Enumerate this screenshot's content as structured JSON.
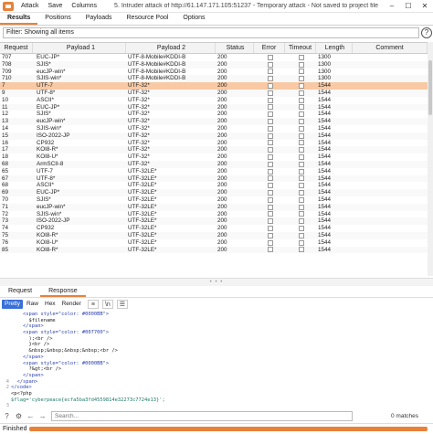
{
  "menu": [
    "Attack",
    "Save",
    "Columns"
  ],
  "window": {
    "title": "5. Intruder attack of http://61.147.171.105:51237 - Temporary attack - Not saved to project file"
  },
  "tabs": [
    "Results",
    "Positions",
    "Payloads",
    "Resource Pool",
    "Options"
  ],
  "filter": {
    "text": "Filter: Showing all items"
  },
  "table": {
    "columns": [
      "Request",
      "Payload 1",
      "Payload 2",
      "Status",
      "Error",
      "Timeout",
      "Length",
      "Comment"
    ],
    "rows": [
      {
        "req": "707",
        "p1": "EUC-JP*",
        "p2": "UTF-8-Mobile#KDDI-B",
        "status": "200",
        "length": "1300"
      },
      {
        "req": "708",
        "p1": "SJIS*",
        "p2": "UTF-8-Mobile#KDDI-B",
        "status": "200",
        "length": "1300"
      },
      {
        "req": "709",
        "p1": "eucJP-win*",
        "p2": "UTF-8-Mobile#KDDI-B",
        "status": "200",
        "length": "1300"
      },
      {
        "req": "710",
        "p1": "SJIS-win*",
        "p2": "UTF-8-Mobile#KDDI-B",
        "status": "200",
        "length": "1300"
      },
      {
        "req": "7",
        "p1": "UTF-7",
        "p2": "UTF-32*",
        "status": "200",
        "length": "1544",
        "selected": true
      },
      {
        "req": "9",
        "p1": "UTF-8*",
        "p2": "UTF-32*",
        "status": "200",
        "length": "1544"
      },
      {
        "req": "10",
        "p1": "ASCII*",
        "p2": "UTF-32*",
        "status": "200",
        "length": "1544"
      },
      {
        "req": "11",
        "p1": "EUC-JP*",
        "p2": "UTF-32*",
        "status": "200",
        "length": "1544"
      },
      {
        "req": "12",
        "p1": "SJIS*",
        "p2": "UTF-32*",
        "status": "200",
        "length": "1544"
      },
      {
        "req": "13",
        "p1": "eucJP-win*",
        "p2": "UTF-32*",
        "status": "200",
        "length": "1544"
      },
      {
        "req": "14",
        "p1": "SJIS-win*",
        "p2": "UTF-32*",
        "status": "200",
        "length": "1544"
      },
      {
        "req": "15",
        "p1": "ISO-2022-JP",
        "p2": "UTF-32*",
        "status": "200",
        "length": "1544"
      },
      {
        "req": "16",
        "p1": "CP932",
        "p2": "UTF-32*",
        "status": "200",
        "length": "1544"
      },
      {
        "req": "17",
        "p1": "KOI8-R*",
        "p2": "UTF-32*",
        "status": "200",
        "length": "1544"
      },
      {
        "req": "18",
        "p1": "KOI8-U*",
        "p2": "UTF-32*",
        "status": "200",
        "length": "1544"
      },
      {
        "req": "68",
        "p1": "ArmSCII-8",
        "p2": "UTF-32*",
        "status": "200",
        "length": "1544"
      },
      {
        "req": "65",
        "p1": "UTF-7",
        "p2": "UTF-32LE*",
        "status": "200",
        "length": "1544"
      },
      {
        "req": "67",
        "p1": "UTF-8*",
        "p2": "UTF-32LE*",
        "status": "200",
        "length": "1544"
      },
      {
        "req": "68",
        "p1": "ASCII*",
        "p2": "UTF-32LE*",
        "status": "200",
        "length": "1544"
      },
      {
        "req": "69",
        "p1": "EUC-JP*",
        "p2": "UTF-32LE*",
        "status": "200",
        "length": "1544"
      },
      {
        "req": "70",
        "p1": "SJIS*",
        "p2": "UTF-32LE*",
        "status": "200",
        "length": "1544"
      },
      {
        "req": "71",
        "p1": "eucJP-win*",
        "p2": "UTF-32LE*",
        "status": "200",
        "length": "1544"
      },
      {
        "req": "72",
        "p1": "SJIS-win*",
        "p2": "UTF-32LE*",
        "status": "200",
        "length": "1544"
      },
      {
        "req": "73",
        "p1": "ISO-2022-JP",
        "p2": "UTF-32LE*",
        "status": "200",
        "length": "1544"
      },
      {
        "req": "74",
        "p1": "CP932",
        "p2": "UTF-32LE*",
        "status": "200",
        "length": "1544"
      },
      {
        "req": "75",
        "p1": "KOI8-R*",
        "p2": "UTF-32LE*",
        "status": "200",
        "length": "1544"
      },
      {
        "req": "76",
        "p1": "KOI8-U*",
        "p2": "UTF-32LE*",
        "status": "200",
        "length": "1544"
      },
      {
        "req": "85",
        "p1": "KOI8-R*",
        "p2": "UTF-32LE*",
        "status": "200",
        "length": "1544"
      }
    ]
  },
  "lower_tabs": [
    "Request",
    "Response"
  ],
  "editor": {
    "buttons": [
      "Pretty",
      "Raw",
      "Hex",
      "Render"
    ],
    "wrap_icon": "\\n",
    "lines": [
      {
        "n": "",
        "t": "    <span style=\"color: #0000BB\">",
        "c": "blue"
      },
      {
        "n": "",
        "t": "      $filename",
        "c": ""
      },
      {
        "n": "",
        "t": "    </span>",
        "c": "blue"
      },
      {
        "n": "",
        "t": "    <span style=\"color: #007700\">",
        "c": "blue"
      },
      {
        "n": "",
        "t": "      );<br />",
        "c": ""
      },
      {
        "n": "",
        "t": "      }<br />",
        "c": ""
      },
      {
        "n": "",
        "t": "      &nbsp;&nbsp;&nbsp;&nbsp;<br />",
        "c": ""
      },
      {
        "n": "",
        "t": "    </span>",
        "c": "blue"
      },
      {
        "n": "",
        "t": "    <span style=\"color: #0000BB\">",
        "c": "blue"
      },
      {
        "n": "",
        "t": "      ?&gt;<br />",
        "c": ""
      },
      {
        "n": "",
        "t": "    </span>",
        "c": "blue"
      },
      {
        "n": "4",
        "t": "  </span>",
        "c": "blue"
      },
      {
        "n": "2",
        "t": "</code>",
        "c": "blue"
      },
      {
        "n": "",
        "t": "<p<?php",
        "c": ""
      },
      {
        "n": "",
        "t": "$flag='cyberpeace{ecfa5ba3fd4559814e32273c7724e13}';",
        "c": "teal"
      },
      {
        "n": "3",
        "t": "",
        "c": ""
      }
    ]
  },
  "search": {
    "placeholder": "Search...",
    "matches": "0 matches"
  },
  "status": {
    "text": "Finished",
    "progress": 1.0
  },
  "colors": {
    "accent": "#e8813a",
    "selected_row": "#f8c9a4",
    "pretty_active": "#3a6fd8"
  }
}
